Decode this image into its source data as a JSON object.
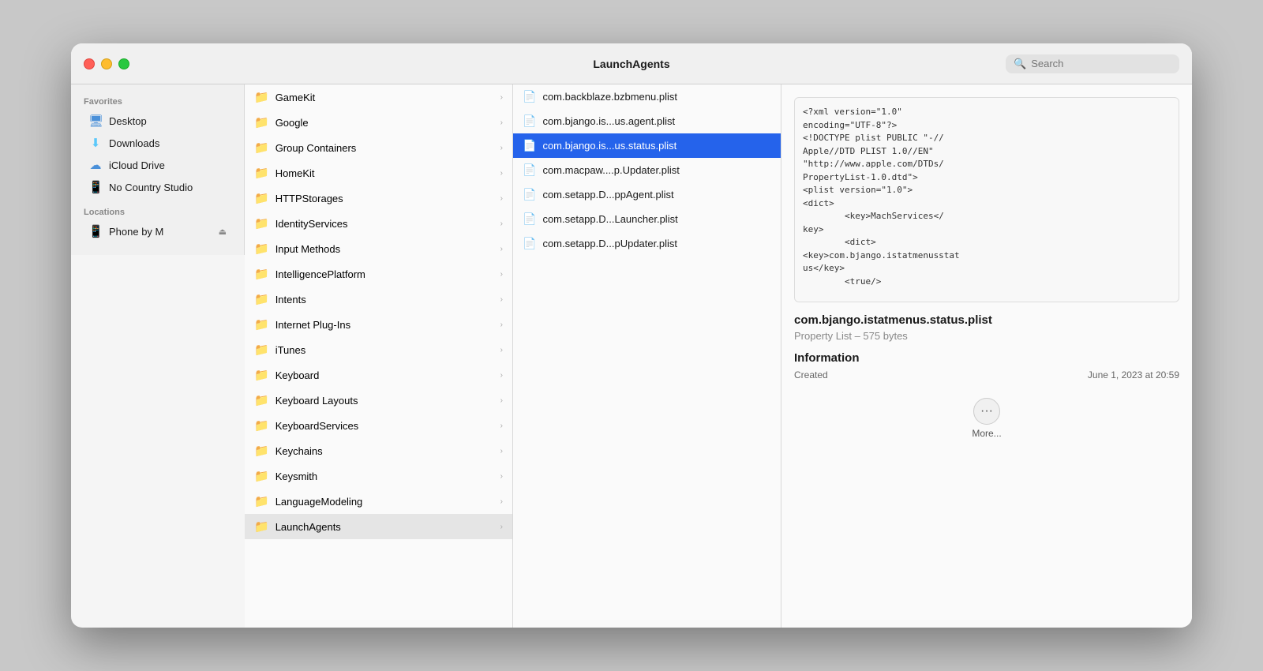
{
  "titlebar": {
    "title": "LaunchAgents",
    "search_placeholder": "Search"
  },
  "sidebar": {
    "favorites_label": "Favorites",
    "items": [
      {
        "id": "desktop",
        "label": "Desktop",
        "icon": "🖥"
      },
      {
        "id": "downloads",
        "label": "Downloads",
        "icon": "⬇"
      },
      {
        "id": "icloud",
        "label": "iCloud Drive",
        "icon": "☁"
      },
      {
        "id": "nocountry",
        "label": "No Country Studio",
        "icon": "📱"
      }
    ],
    "locations_label": "Locations",
    "locations": [
      {
        "id": "phone",
        "label": "Phone by M",
        "icon": "📱",
        "eject": true
      }
    ]
  },
  "column1": {
    "folders": [
      {
        "id": "gamekit",
        "name": "GameKit",
        "selected": false,
        "current": false
      },
      {
        "id": "google",
        "name": "Google",
        "selected": false,
        "current": false
      },
      {
        "id": "groupcontainers",
        "name": "Group Containers",
        "selected": false,
        "current": false
      },
      {
        "id": "homekit",
        "name": "HomeKit",
        "selected": false,
        "current": false
      },
      {
        "id": "httpstorages",
        "name": "HTTPStorages",
        "selected": false,
        "current": false
      },
      {
        "id": "identityservices",
        "name": "IdentityServices",
        "selected": false,
        "current": false
      },
      {
        "id": "inputmethods",
        "name": "Input Methods",
        "selected": false,
        "current": false
      },
      {
        "id": "intelligenceplatform",
        "name": "IntelligencePlatform",
        "selected": false,
        "current": false
      },
      {
        "id": "intents",
        "name": "Intents",
        "selected": false,
        "current": false
      },
      {
        "id": "internetplugins",
        "name": "Internet Plug-Ins",
        "selected": false,
        "current": false
      },
      {
        "id": "itunes",
        "name": "iTunes",
        "selected": false,
        "current": false
      },
      {
        "id": "keyboard",
        "name": "Keyboard",
        "selected": false,
        "current": false
      },
      {
        "id": "keyboardlayouts",
        "name": "Keyboard Layouts",
        "selected": false,
        "current": false
      },
      {
        "id": "keyboardservices",
        "name": "KeyboardServices",
        "selected": false,
        "current": false
      },
      {
        "id": "keychains",
        "name": "Keychains",
        "selected": false,
        "current": false
      },
      {
        "id": "keysmith",
        "name": "Keysmith",
        "selected": false,
        "current": false
      },
      {
        "id": "languagemodeling",
        "name": "LanguageModeling",
        "selected": false,
        "current": false
      },
      {
        "id": "launchagents",
        "name": "LaunchAgents",
        "selected": false,
        "current": true
      }
    ]
  },
  "column2": {
    "files": [
      {
        "id": "backblaze",
        "name": "com.backblaze.bzbmenu.plist",
        "selected": false
      },
      {
        "id": "bjango1",
        "name": "com.bjango.is...us.agent.plist",
        "selected": false
      },
      {
        "id": "bjango2",
        "name": "com.bjango.is...us.status.plist",
        "selected": true
      },
      {
        "id": "macpaw",
        "name": "com.macpaw....p.Updater.plist",
        "selected": false
      },
      {
        "id": "setapp1",
        "name": "com.setapp.D...ppAgent.plist",
        "selected": false
      },
      {
        "id": "setapp2",
        "name": "com.setapp.D...Launcher.plist",
        "selected": false
      },
      {
        "id": "setapp3",
        "name": "com.setapp.D...pUpdater.plist",
        "selected": false
      }
    ]
  },
  "preview": {
    "code_content": "<?xml version=\"1.0\"\nencoding=\"UTF-8\"?>\n<!DOCTYPE plist PUBLIC \"-//\nApple//DTD PLIST 1.0//EN\"\n\"http://www.apple.com/DTDs/\nPropertyList-1.0.dtd\">\n<plist version=\"1.0\">\n<dict>\n        <key>MachServices</\nkey>\n        <dict>\n<key>com.bjango.istatmenusstat\nus</key>\n        <true/>",
    "filename": "com.bjango.istatmenus.status.plist",
    "subtext": "Property List – 575 bytes",
    "section_title": "Information",
    "info_rows": [
      {
        "label": "Created",
        "value": "June 1, 2023 at 20:59"
      }
    ],
    "more_label": "More..."
  }
}
